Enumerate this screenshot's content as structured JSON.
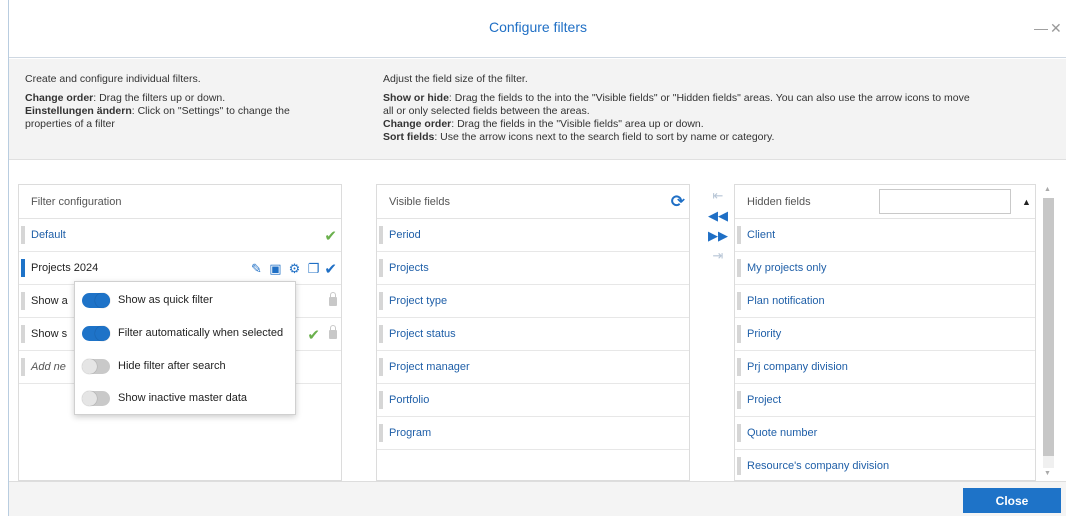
{
  "dialog": {
    "title": "Configure filters",
    "minimize_icon": "minimize-icon",
    "close_icon": "close-icon"
  },
  "help": {
    "left": {
      "head": "Create and configure individual filters.",
      "line1_bold": "Change order",
      "line1_text": ": Drag the filters up or down.",
      "line2_bold": "Einstellungen ändern",
      "line2_text": ": Click on \"Settings\" to change the",
      "line3_text": "properties of a filter"
    },
    "right": {
      "head": "Adjust the field size of the filter.",
      "line1_bold": "Show or hide",
      "line1_text": ": Drag the fields to the into the \"Visible fields\" or \"Hidden fields\" areas. You can also use the arrow icons to move",
      "line2_text": "all or only selected fields between the areas.",
      "line3_bold": "Change order",
      "line3_text": ": Drag the fields in the \"Visible fields\" area up or down.",
      "line4_bold": "Sort fields",
      "line4_text": ": Use the arrow icons next to the search field to sort by name or category."
    }
  },
  "filter_config": {
    "header": "Filter configuration",
    "rows": [
      {
        "label": "Default"
      },
      {
        "label": "Projects 2024"
      },
      {
        "label": "Show a"
      },
      {
        "label": "Show s"
      },
      {
        "label": "Add ne"
      }
    ]
  },
  "popup": {
    "options": [
      {
        "label": "Show as quick filter",
        "on": true
      },
      {
        "label": "Filter automatically when selected",
        "on": true
      },
      {
        "label": "Hide filter after search",
        "on": false
      },
      {
        "label": "Show inactive master data",
        "on": false
      }
    ]
  },
  "visible_fields": {
    "header": "Visible fields",
    "items": [
      "Period",
      "Projects",
      "Project type",
      "Project status",
      "Project manager",
      "Portfolio",
      "Program"
    ]
  },
  "hidden_fields": {
    "header": "Hidden fields",
    "search_value": "",
    "items": [
      "Client",
      "My projects only",
      "Plan notification",
      "Priority",
      "Prj company division",
      "Project",
      "Quote number",
      "Resource's company division"
    ]
  },
  "footer": {
    "close_label": "Close"
  },
  "colors": {
    "accent": "#1e73c8",
    "title": "#1f6fc5",
    "check_green": "#6ab04c"
  }
}
